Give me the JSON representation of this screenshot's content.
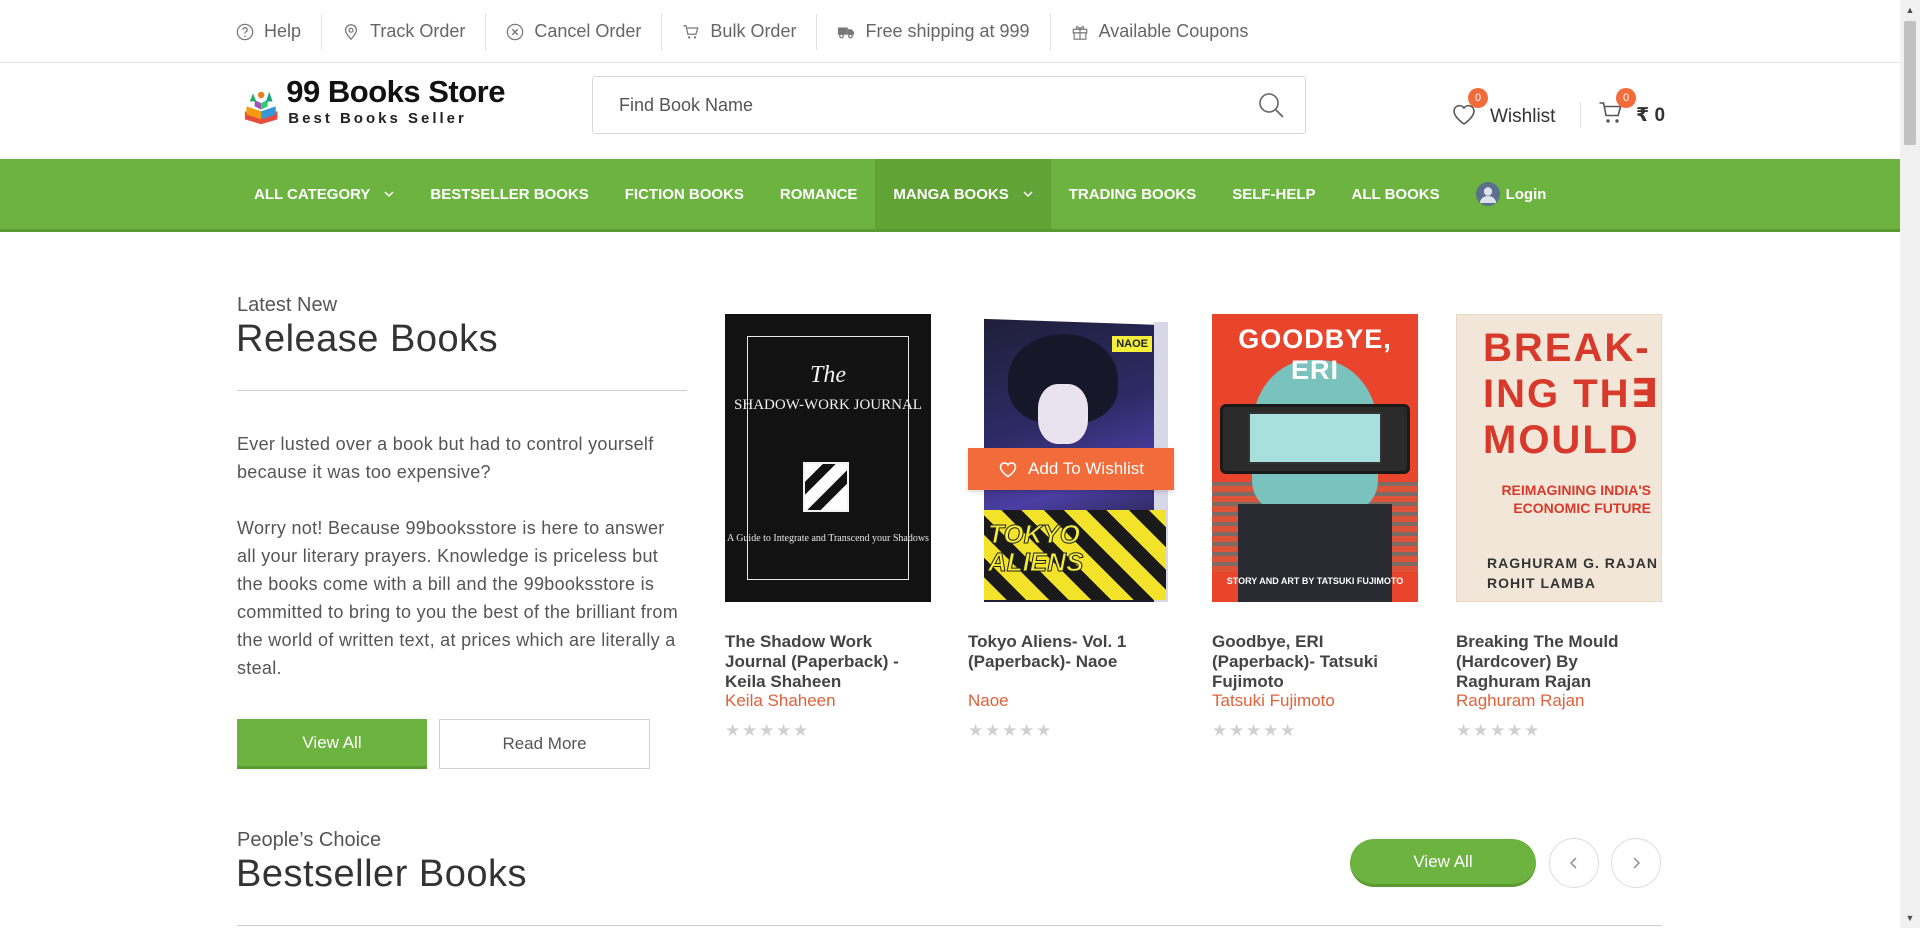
{
  "topbar": {
    "items": [
      {
        "label": "Help",
        "icon": "help-circle-icon"
      },
      {
        "label": "Track Order",
        "icon": "map-pin-icon"
      },
      {
        "label": "Cancel Order",
        "icon": "cancel-circle-icon"
      },
      {
        "label": "Bulk Order",
        "icon": "cart-icon"
      },
      {
        "label": "Free shipping at 999",
        "icon": "truck-icon"
      },
      {
        "label": "Available Coupons",
        "icon": "gift-icon"
      }
    ]
  },
  "header": {
    "logo_title": "99 Books Store",
    "logo_subtitle": "Best Books Seller",
    "search_placeholder": "Find Book Name",
    "wishlist_label": "Wishlist",
    "wishlist_count": "0",
    "cart_label": "₹ 0",
    "cart_count": "0"
  },
  "nav": {
    "items": [
      {
        "label": "ALL CATEGORY",
        "has_dropdown": true
      },
      {
        "label": "BESTSELLER BOOKS"
      },
      {
        "label": "FICTION BOOKS"
      },
      {
        "label": "ROMANCE"
      },
      {
        "label": "MANGA BOOKS",
        "has_dropdown": true,
        "active": true
      },
      {
        "label": "TRADING BOOKS"
      },
      {
        "label": "SELF-HELP"
      },
      {
        "label": "ALL BOOKS"
      }
    ],
    "login_label": "Login"
  },
  "release": {
    "kicker": "Latest New",
    "title": "Release Books",
    "para1": "Ever lusted over a book but had to control yourself because it was too expensive?",
    "para2": "Worry not! Because 99booksstore is here to answer all your literary prayers. Knowledge is priceless but the books come with a bill and the 99booksstore is committed to bring to you the best of the brilliant from the world of written text, at prices which are literally a steal.",
    "view_all_label": "View All",
    "read_more_label": "Read More",
    "add_to_wishlist_label": "Add To Wishlist",
    "books": [
      {
        "title": "The Shadow Work Journal (Paperback) - Keila Shaheen",
        "author": "Keila Shaheen",
        "rating": 0,
        "cover_text": {
          "line1": "The",
          "line2": "SHADOW-WORK JOURNAL",
          "line3": "A Guide to Integrate and Transcend your Shadows"
        }
      },
      {
        "title": "Tokyo Aliens- Vol. 1 (Paperback)- Naoe",
        "author": "Naoe",
        "rating": 0,
        "cover_text": {
          "brand": "NAOE",
          "title": "TOKYO ALIENS"
        }
      },
      {
        "title": "Goodbye, ERI (Paperback)- Tatsuki Fujimoto",
        "author": "Tatsuki Fujimoto",
        "rating": 0,
        "cover_text": {
          "title": "GOODBYE, ERI",
          "foot": "STORY AND ART BY TATSUKI FUJIMOTO"
        }
      },
      {
        "title": "Breaking The Mould (Hardcover) By Raghuram Rajan",
        "author": "Raghuram Rajan",
        "rating": 0,
        "cover_text": {
          "title": "BREAK- ING TH∃ MOULD",
          "sub": "REIMAGINING INDIA'S ECONOMIC FUTURE",
          "authors": "RAGHURAM G. RAJAN ROHIT LAMBA"
        }
      }
    ]
  },
  "bestseller": {
    "kicker": "People’s Choice",
    "title": "Bestseller Books",
    "view_all_label": "View All"
  },
  "colors": {
    "brand_green": "#6db33f",
    "accent_orange": "#f26b3a",
    "author_red": "#e0613a"
  }
}
